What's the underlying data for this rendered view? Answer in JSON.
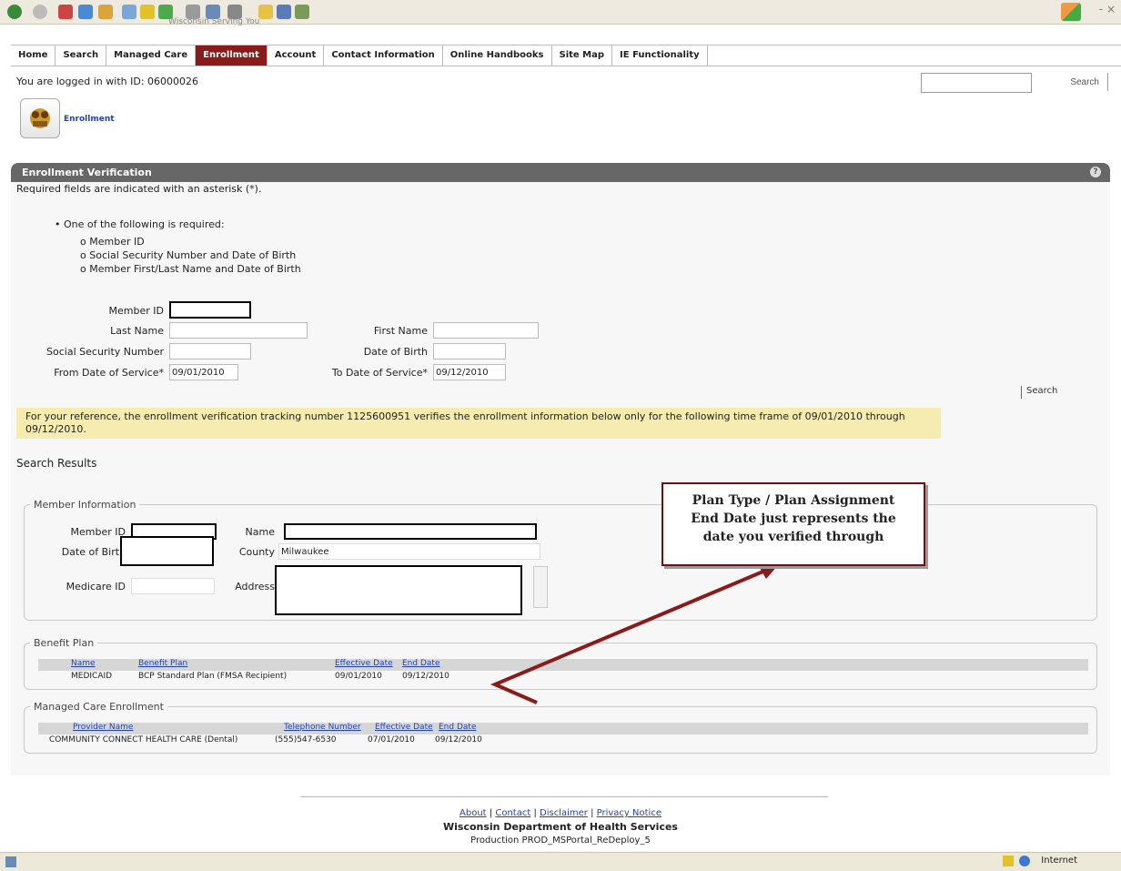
{
  "toolbar": {
    "subtitle": "Wisconsin Serving You",
    "window_controls": "- ×"
  },
  "nav": {
    "items": [
      "Home",
      "Search",
      "Managed Care",
      "Enrollment",
      "Account",
      "Contact Information",
      "Online Handbooks",
      "Site Map",
      "IE Functionality"
    ],
    "active": "Enrollment"
  },
  "header": {
    "logged_in_text": "You are logged in with ID: 06000026",
    "search_button": "Search",
    "enrollment_link": "Enrollment"
  },
  "panel": {
    "title": "Enrollment Verification",
    "required_note": "Required fields are indicated with an asterisk (*).",
    "requirement_intro": "One of the following is required:",
    "requirement_options": [
      "Member ID",
      "Social Security Number and Date of Birth",
      "Member First/Last Name and Date of Birth"
    ]
  },
  "form": {
    "member_id_label": "Member ID",
    "last_name_label": "Last Name",
    "first_name_label": "First Name",
    "ssn_label": "Social Security Number",
    "dob_label": "Date of Birth",
    "from_dos_label": "From Date of Service*",
    "from_dos_value": "09/01/2010",
    "to_dos_label": "To Date of Service*",
    "to_dos_value": "09/12/2010",
    "search_link": "Search"
  },
  "notice": "For your reference, the enrollment verification tracking number 1125600951 verifies the enrollment information below only for the following time frame of 09/01/2010 through 09/12/2010.",
  "results": {
    "title": "Search Results",
    "member_info": {
      "legend": "Member Information",
      "member_id_label": "Member ID",
      "name_label": "Name",
      "dob_label": "Date of Birth",
      "county_label": "County",
      "county_value": "Milwaukee",
      "medicare_id_label": "Medicare ID",
      "address_label": "Address"
    },
    "benefit_plan": {
      "legend": "Benefit Plan",
      "columns": [
        "Name",
        "Benefit Plan",
        "Effective Date",
        "End Date"
      ],
      "rows": [
        [
          "MEDICAID",
          "BCP Standard Plan (FMSA Recipient)",
          "09/01/2010",
          "09/12/2010"
        ]
      ]
    },
    "managed_care": {
      "legend": "Managed Care Enrollment",
      "columns": [
        "Provider Name",
        "Telephone Number",
        "Effective Date",
        "End Date"
      ],
      "rows": [
        [
          "COMMUNITY CONNECT HEALTH CARE (Dental)",
          "(555)547-6530",
          "07/01/2010",
          "09/12/2010"
        ]
      ]
    }
  },
  "callout": {
    "line1": "Plan Type / Plan Assignment",
    "line2": "End Date just represents the",
    "line3": "date you verified through"
  },
  "footer": {
    "links": [
      "About",
      "Contact",
      "Disclaimer",
      "Privacy Notice"
    ],
    "separator": "|",
    "org": "Wisconsin Department of Health Services",
    "production": "Production PROD_MSPortal_ReDeploy_5"
  },
  "statusbar": {
    "zone": "Internet"
  },
  "colors": {
    "nav_active": "#8b1a1a",
    "panel_header": "#676767",
    "notice_bg": "#f6ecb0",
    "callout_border": "#6e1010",
    "arrow": "#8b1a1a",
    "link": "#2244aa"
  }
}
